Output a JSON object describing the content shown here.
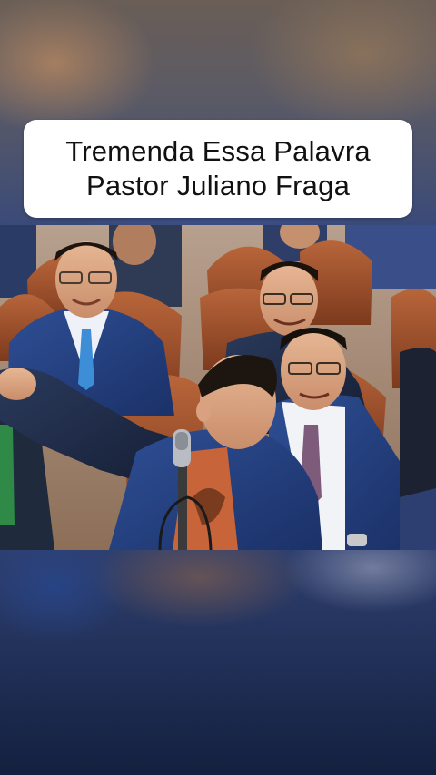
{
  "caption": {
    "line1": "Tremenda Essa Palavra",
    "line2": "Pastor Juliano Fraga"
  },
  "colors": {
    "caption_bg": "#ffffff",
    "caption_text": "#111111",
    "suit_blue": "#23407f",
    "chair_wood": "#a4532c"
  }
}
